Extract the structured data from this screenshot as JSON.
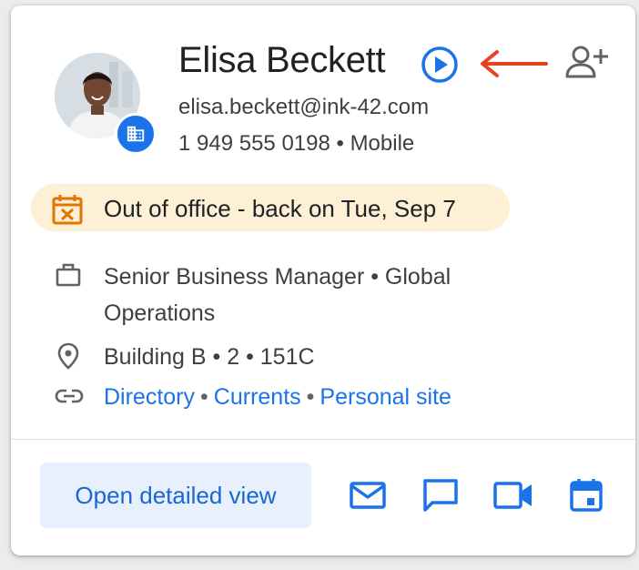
{
  "contact": {
    "name": "Elisa Beckett",
    "email": "elisa.beckett@ink-42.com",
    "phone": "1 949 555 0198 • Mobile"
  },
  "status": {
    "out_of_office": "Out of office - back on Tue, Sep 7"
  },
  "details": {
    "title_line1": "Senior Business Manager • Global",
    "title_line2": "Operations",
    "location": "Building B • 2 • 151C",
    "links": [
      {
        "label": "Directory"
      },
      {
        "label": "Currents"
      },
      {
        "label": "Personal site"
      }
    ],
    "separator": "•"
  },
  "footer": {
    "open_detailed_view": "Open detailed view"
  },
  "icons": {
    "play": "play-circle-icon",
    "annotation": "red-arrow-icon",
    "add_contact": "add-person-icon",
    "building": "building-icon",
    "calendar_off": "calendar-off-icon",
    "work": "briefcase-icon",
    "location": "location-pin-icon",
    "link": "link-icon",
    "email": "mail-icon",
    "chat": "chat-icon",
    "video": "video-icon",
    "calendar": "calendar-icon"
  },
  "colors": {
    "accent": "#1a73e8",
    "annotation": "#e8431f",
    "ooo_background": "#fdf0d5",
    "ooo_icon": "#e37400"
  }
}
